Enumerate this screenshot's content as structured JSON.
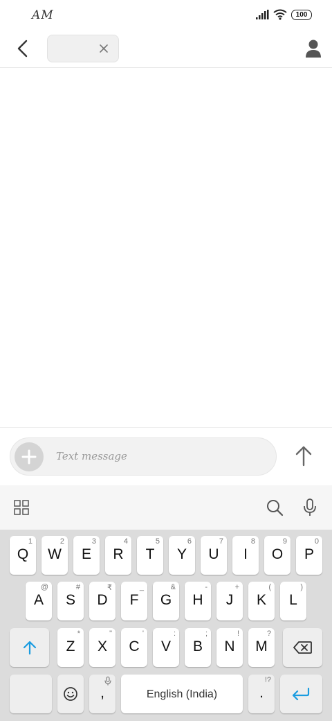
{
  "status_bar": {
    "time": "AM",
    "battery": "100"
  },
  "header": {
    "recipient_value": "",
    "icons": {
      "back": "back-arrow-icon",
      "clear": "close-icon",
      "contact": "person-icon"
    }
  },
  "compose": {
    "placeholder": "Text message",
    "icons": {
      "attach": "plus-icon",
      "send": "send-arrow-icon"
    }
  },
  "keyboard_toolbar": {
    "icons": [
      "grid-icon",
      "search-icon",
      "mic-icon"
    ]
  },
  "keyboard": {
    "row1": [
      {
        "key": "Q",
        "alt": "1"
      },
      {
        "key": "W",
        "alt": "2"
      },
      {
        "key": "E",
        "alt": "3"
      },
      {
        "key": "R",
        "alt": "4"
      },
      {
        "key": "T",
        "alt": "5"
      },
      {
        "key": "Y",
        "alt": "6"
      },
      {
        "key": "U",
        "alt": "7"
      },
      {
        "key": "I",
        "alt": "8"
      },
      {
        "key": "O",
        "alt": "9"
      },
      {
        "key": "P",
        "alt": "0"
      }
    ],
    "row2": [
      {
        "key": "A",
        "alt": "@"
      },
      {
        "key": "S",
        "alt": "#"
      },
      {
        "key": "D",
        "alt": "₹"
      },
      {
        "key": "F",
        "alt": "_"
      },
      {
        "key": "G",
        "alt": "&"
      },
      {
        "key": "H",
        "alt": "-"
      },
      {
        "key": "J",
        "alt": "+"
      },
      {
        "key": "K",
        "alt": "("
      },
      {
        "key": "L",
        "alt": ")"
      }
    ],
    "row3": [
      {
        "key": "Z",
        "alt": "*"
      },
      {
        "key": "X",
        "alt": "\""
      },
      {
        "key": "C",
        "alt": "'"
      },
      {
        "key": "V",
        "alt": ":"
      },
      {
        "key": "B",
        "alt": ";"
      },
      {
        "key": "N",
        "alt": "!"
      },
      {
        "key": "M",
        "alt": "?"
      }
    ],
    "comma": ",",
    "period": ".",
    "period_alt": "!?",
    "space_label": "English (India)",
    "accent_color": "#1a9ce0"
  }
}
